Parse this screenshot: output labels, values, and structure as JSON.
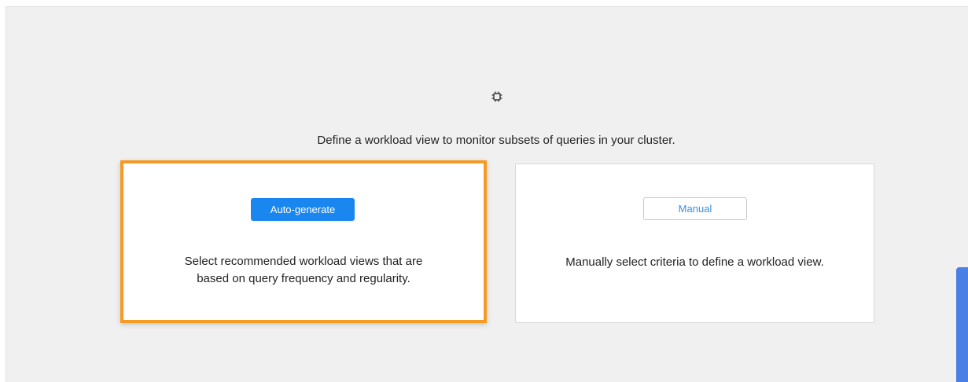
{
  "intro_text": "Define a workload view to monitor subsets of queries in your cluster.",
  "icons": {
    "chip": "chip-icon"
  },
  "options": {
    "auto": {
      "button_label": "Auto-generate",
      "description_line1": "Select recommended workload views that are",
      "description_line2": "based on query frequency and regularity.",
      "selected": true
    },
    "manual": {
      "button_label": "Manual",
      "description_line1": "Manually select criteria to define a workload view."
    }
  },
  "colors": {
    "accent": "#1a86f0",
    "selection_outline": "#f59a23",
    "link_text": "#3a8ee6",
    "panel_background": "#f0f0f0"
  }
}
